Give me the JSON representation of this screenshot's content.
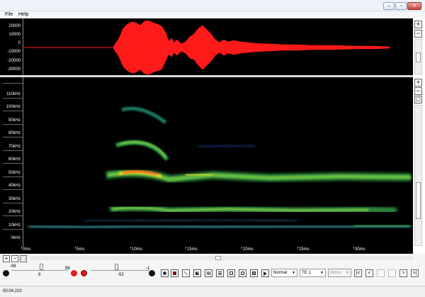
{
  "menu": {
    "file": "File",
    "help": "Help"
  },
  "window_buttons": {
    "minimize": "–",
    "maximize": "▫",
    "close": "✕"
  },
  "waveform": {
    "y_labels": [
      "20000",
      "10000",
      "0",
      "-10000",
      "-20000",
      "-30000"
    ],
    "color": "#ff1a1a"
  },
  "spectrogram": {
    "freq_labels": [
      "110kHz",
      "100kHz",
      "90kHz",
      "80kHz",
      "70kHz",
      "60kHz",
      "50kHz",
      "40kHz",
      "30kHz",
      "20kHz",
      "10kHz",
      "0kHz"
    ]
  },
  "time_axis": {
    "labels": [
      "0ms",
      "5ms",
      "10ms",
      "15ms",
      "20ms",
      "25ms",
      "30ms"
    ]
  },
  "side_buttons": {
    "plus": "+",
    "minus": "−",
    "fit": "□"
  },
  "bottom_left_buttons": {
    "plus": "+",
    "minus": "−",
    "fit": "□"
  },
  "controls": {
    "slider1_min": "-96",
    "slider1_value": "8",
    "slider1_max": "96",
    "slider2_value": "-52",
    "slider2_max": "-1",
    "mode_select": "Normal",
    "te_select": "TE  1",
    "channel_select": "Mono"
  },
  "status": {
    "time": "00:04.210"
  },
  "icons": [
    "record-icon",
    "cursor-icon",
    "select-icon",
    "zoom-icon",
    "fill-icon",
    "grid-icon",
    "list-icon",
    "box-icon",
    "camera-icon",
    "export-icon",
    "play-icon"
  ]
}
